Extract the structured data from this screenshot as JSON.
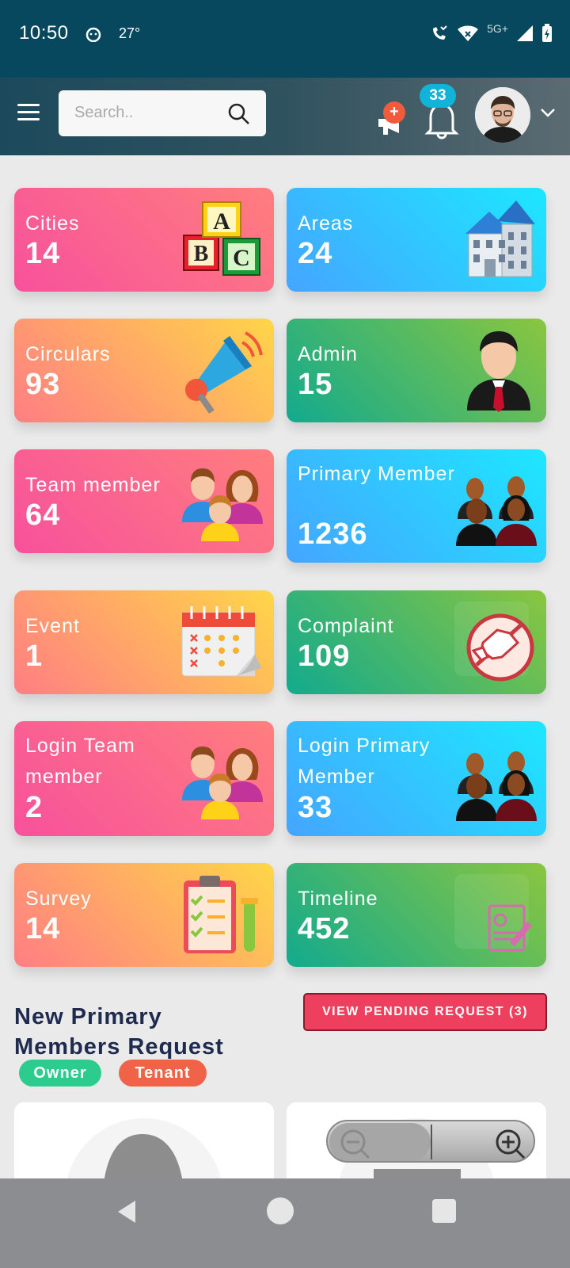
{
  "status_bar": {
    "time": "10:50",
    "temperature": "27°",
    "network": "5G+"
  },
  "header": {
    "search_placeholder": "Search..",
    "announcement_badge": "+",
    "notification_count": "33"
  },
  "cards": [
    {
      "label": "Cities",
      "value": "14",
      "icon": "abc-blocks-icon",
      "gradient": "pink"
    },
    {
      "label": "Areas",
      "value": "24",
      "icon": "building-icon",
      "gradient": "blue"
    },
    {
      "label": "Circulars",
      "value": "93",
      "icon": "megaphone-icon",
      "gradient": "orange"
    },
    {
      "label": "Admin",
      "value": "15",
      "icon": "admin-user-icon",
      "gradient": "green"
    },
    {
      "label": "Team member",
      "value": "64",
      "icon": "family-icon",
      "gradient": "pink"
    },
    {
      "label": "Primary Member",
      "value": "1236",
      "icon": "group-icon",
      "gradient": "blue"
    },
    {
      "label": "Event",
      "value": "1",
      "icon": "calendar-icon",
      "gradient": "orange"
    },
    {
      "label": "Complaint",
      "value": "109",
      "icon": "complaint-handshake-icon",
      "gradient": "green"
    },
    {
      "label": "Login Team member",
      "value": "2",
      "icon": "family-icon",
      "gradient": "pink"
    },
    {
      "label": "Login Primary Member",
      "value": "33",
      "icon": "group-icon",
      "gradient": "blue"
    },
    {
      "label": "Survey",
      "value": "14",
      "icon": "clipboard-icon",
      "gradient": "orange"
    },
    {
      "label": "Timeline",
      "value": "452",
      "icon": "document-sign-icon",
      "gradient": "green"
    }
  ],
  "requests": {
    "title": "New Primary Members Request",
    "pending_button": "VIEW PENDING REQUEST (3)",
    "chips": [
      "Owner",
      "Tenant"
    ]
  }
}
